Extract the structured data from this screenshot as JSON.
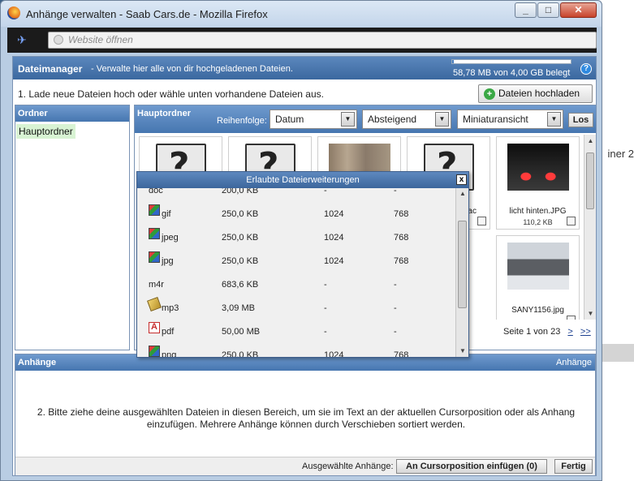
{
  "window": {
    "title": "Anhänge verwalten - Saab Cars.de - Mozilla Firefox",
    "url_placeholder": "Website öffnen"
  },
  "background": {
    "text": "iner 2"
  },
  "dialog": {
    "title": "Dateimanager",
    "subtitle": "- Verwalte hier alle von dir hochgeladenen Dateien.",
    "storage_text": "58,78 MB von 4,00 GB belegt",
    "storage_used_fraction": 0.0147,
    "help": "?",
    "step1": "1. Lade neue Dateien hoch oder wähle unten vorhandene Dateien aus.",
    "upload_label": "Dateien hochladen"
  },
  "folders": {
    "header": "Ordner",
    "items": [
      "Hauptordner"
    ]
  },
  "main": {
    "header": "Hauptordner",
    "sort_label": "Reihenfolge:",
    "sort_by": "Datum",
    "direction": "Absteigend",
    "view": "Miniaturansicht",
    "go_label": "Los",
    "thumbs": [
      {
        "type": "doc",
        "caption": "",
        "size": ""
      },
      {
        "type": "doc",
        "caption": "",
        "size": ""
      },
      {
        "type": "building",
        "caption": "",
        "size": ""
      },
      {
        "type": "doc",
        "caption": "blac",
        "size": ""
      },
      {
        "type": "night",
        "caption": "licht hinten.JPG",
        "size": "110,2 KB"
      },
      {
        "type": "car",
        "caption": "SANY1156.jpg",
        "size": ""
      }
    ],
    "pager": {
      "text": "Seite 1 von 23",
      "next": ">",
      "last": ">>"
    }
  },
  "popup": {
    "title": "Erlaubte Dateierweiterungen",
    "close": "x",
    "rows": [
      {
        "ext": "doc",
        "size": "200,0 KB",
        "w": "-",
        "h": "-",
        "icon": "none"
      },
      {
        "ext": "gif",
        "size": "250,0 KB",
        "w": "1024",
        "h": "768",
        "icon": "image"
      },
      {
        "ext": "jpeg",
        "size": "250,0 KB",
        "w": "1024",
        "h": "768",
        "icon": "image"
      },
      {
        "ext": "jpg",
        "size": "250,0 KB",
        "w": "1024",
        "h": "768",
        "icon": "image"
      },
      {
        "ext": "m4r",
        "size": "683,6 KB",
        "w": "-",
        "h": "-",
        "icon": "none"
      },
      {
        "ext": "mp3",
        "size": "3,09 MB",
        "w": "-",
        "h": "-",
        "icon": "mp3"
      },
      {
        "ext": "pdf",
        "size": "50,00 MB",
        "w": "-",
        "h": "-",
        "icon": "pdf"
      },
      {
        "ext": "png",
        "size": "250,0 KB",
        "w": "1024",
        "h": "768",
        "icon": "image"
      }
    ]
  },
  "attachments": {
    "header": "Anhänge",
    "header_right": "Anhänge",
    "step2_line1": "2. Bitte ziehe deine ausgewählten Dateien in diesen Bereich, um sie im Text an der aktuellen Cursorposition oder als Anhang",
    "step2_line2": "einzufügen. Mehrere Anhänge können durch Verschieben sortiert werden.",
    "selected_label": "Ausgewählte Anhänge:",
    "insert_label": "An Cursorposition einfügen (0)",
    "done_label": "Fertig"
  }
}
